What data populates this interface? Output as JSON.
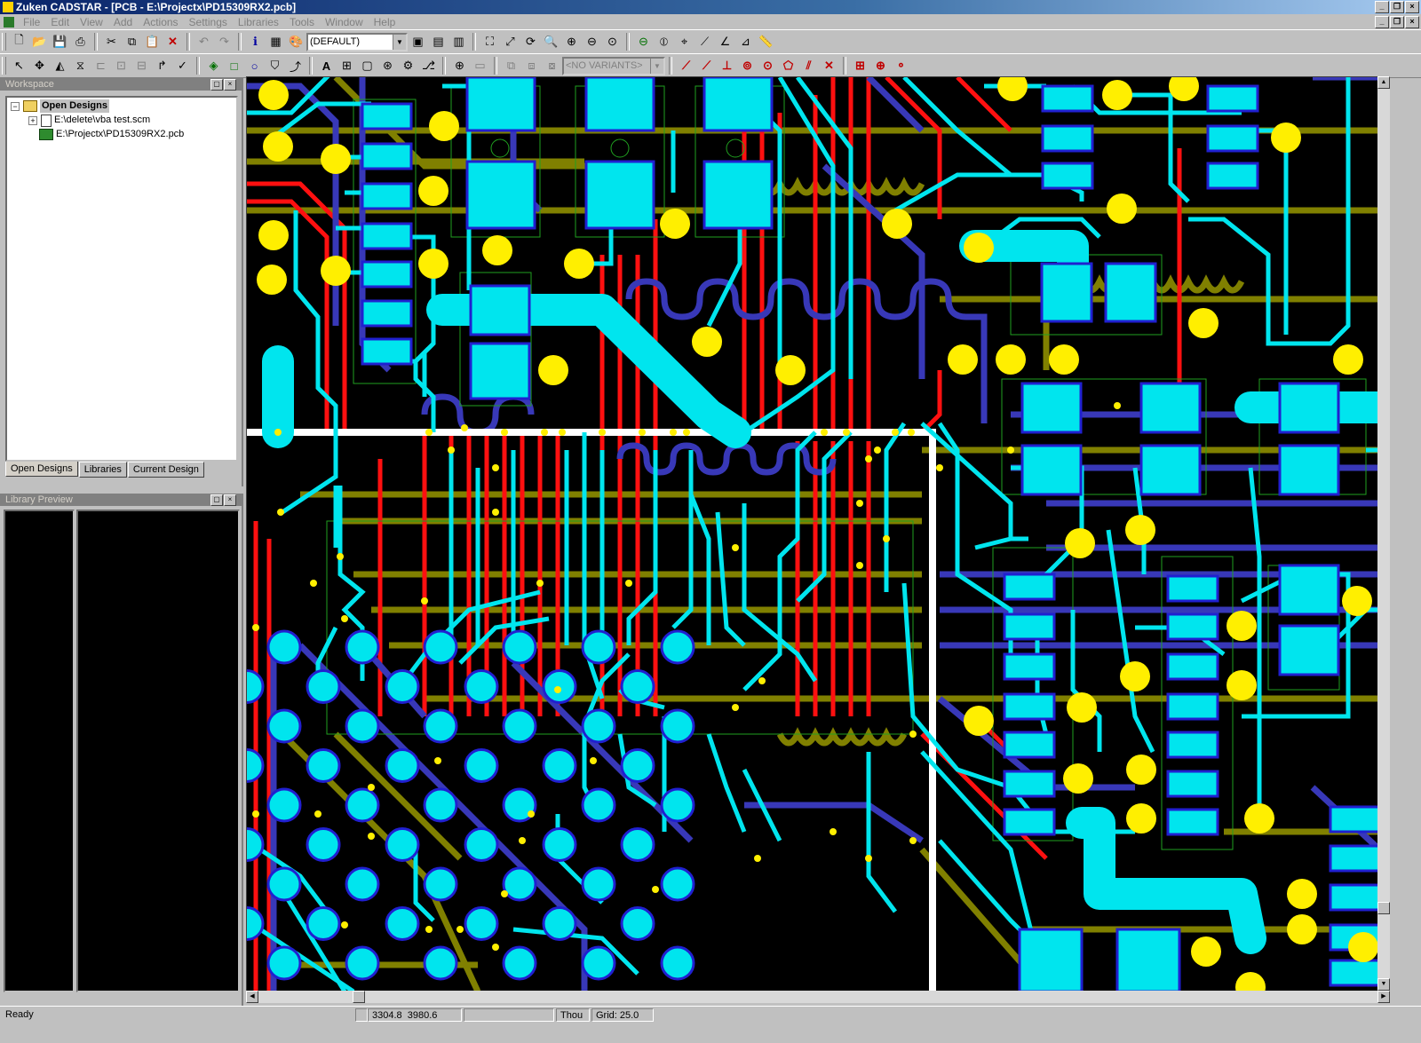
{
  "window": {
    "title": "Zuken CADSTAR - [PCB - E:\\Projectx\\PD15309RX2.pcb]",
    "buttons": [
      "minimize-icon",
      "restore-icon",
      "close-icon"
    ]
  },
  "menu": {
    "items": [
      "File",
      "Edit",
      "View",
      "Add",
      "Actions",
      "Settings",
      "Libraries",
      "Tools",
      "Window",
      "Help"
    ]
  },
  "toolbar": {
    "layer_combo": "(DEFAULT)",
    "variants_combo": "<NO VARIANTS>"
  },
  "workspace": {
    "title": "Workspace",
    "tree": {
      "root": "Open Designs",
      "items": [
        "E:\\delete\\vba test.scm",
        "E:\\Projectx\\PD15309RX2.pcb"
      ]
    },
    "tabs": [
      "Open Designs",
      "Libraries",
      "Current Design"
    ],
    "active_tab": "Open Designs"
  },
  "library_preview": {
    "title": "Library Preview"
  },
  "status": {
    "message": "Ready",
    "coord_x": "3304.8",
    "coord_y": "3980.6",
    "units": "Thou",
    "grid": "Grid: 25.0"
  },
  "colors": {
    "board_bg": "#000000",
    "pad": "#00e5ee",
    "pad_outline": "#2020d0",
    "via": "#ffef00",
    "trace_red": "#ff1010",
    "trace_olive": "#808000",
    "trace_blue": "#3838b8",
    "board_edge": "#ffffff"
  }
}
